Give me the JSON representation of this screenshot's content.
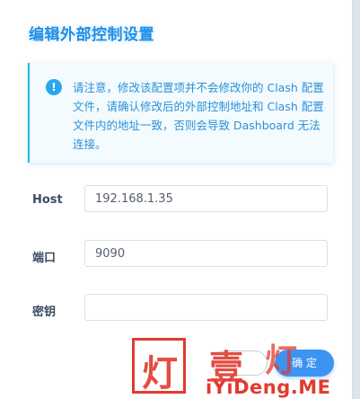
{
  "dialog": {
    "title": "编辑外部控制设置"
  },
  "notice": {
    "icon": "info-icon",
    "icon_glyph": "!",
    "text": "请注意，修改该配置项并不会修改你的 Clash 配置文件，请确认修改后的外部控制地址和 Clash 配置文件内的地址一致，否则会导致 Dashboard 无法连接。"
  },
  "form": {
    "host_label": "Host",
    "host_value": "192.168.1.35",
    "port_label": "端口",
    "port_value": "9090",
    "secret_label": "密钥",
    "secret_value": ""
  },
  "buttons": {
    "cancel_label": "",
    "confirm_label": "确 定"
  },
  "watermark": {
    "char_box": "灯",
    "char_mid": "壹",
    "char_right": "灯",
    "text": "iYiDeng.ME"
  },
  "colors": {
    "accent": "#1f8fe8",
    "notice_border": "#27b3e6",
    "confirm_bg": "#3d94f0",
    "watermark_red": "#e23a2e"
  }
}
